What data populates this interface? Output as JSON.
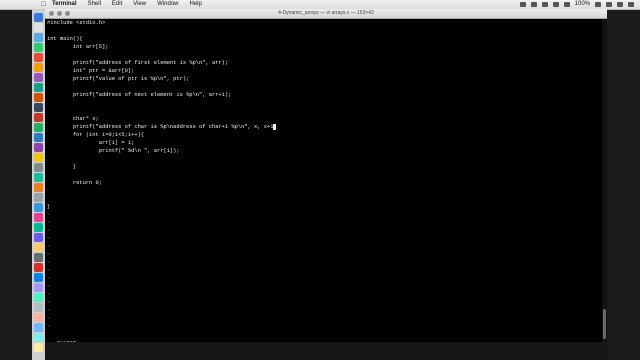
{
  "menubar": {
    "apple": "",
    "items": [
      "Terminal",
      "Shell",
      "Edit",
      "View",
      "Window",
      "Help"
    ],
    "battery": "100%"
  },
  "window": {
    "title": "4-Dynamic_arrays — vi arrays.c — 153×42"
  },
  "editor": {
    "lines": [
      "#include <stdio.h>",
      "",
      "int main(){",
      "        int arr[5];",
      "",
      "        printf(\"address of first element is %p\\n\", arr);",
      "        int* ptr = &arr[0];",
      "        printf(\"value of ptr is %p\\n\", ptr);",
      "",
      "        printf(\"address of next element is %p\\n\", arr+1);",
      "",
      "",
      "        char* x;",
      "        printf(\"address of char is %p\\naddress of char+1 %p\\n\", x, x+1",
      "        for (int i=0;i<5;i++){",
      "                arr[i] = i;",
      "                printf(\" %d\\n \", arr[i]);",
      "",
      "        }",
      "",
      "        return 0;",
      "",
      "",
      "}"
    ],
    "tilde": "~",
    "mode": "-- INSERT --"
  },
  "colors": {
    "tilde": "#4f6fd0",
    "background": "#000000",
    "text": "#f0f0f0"
  }
}
